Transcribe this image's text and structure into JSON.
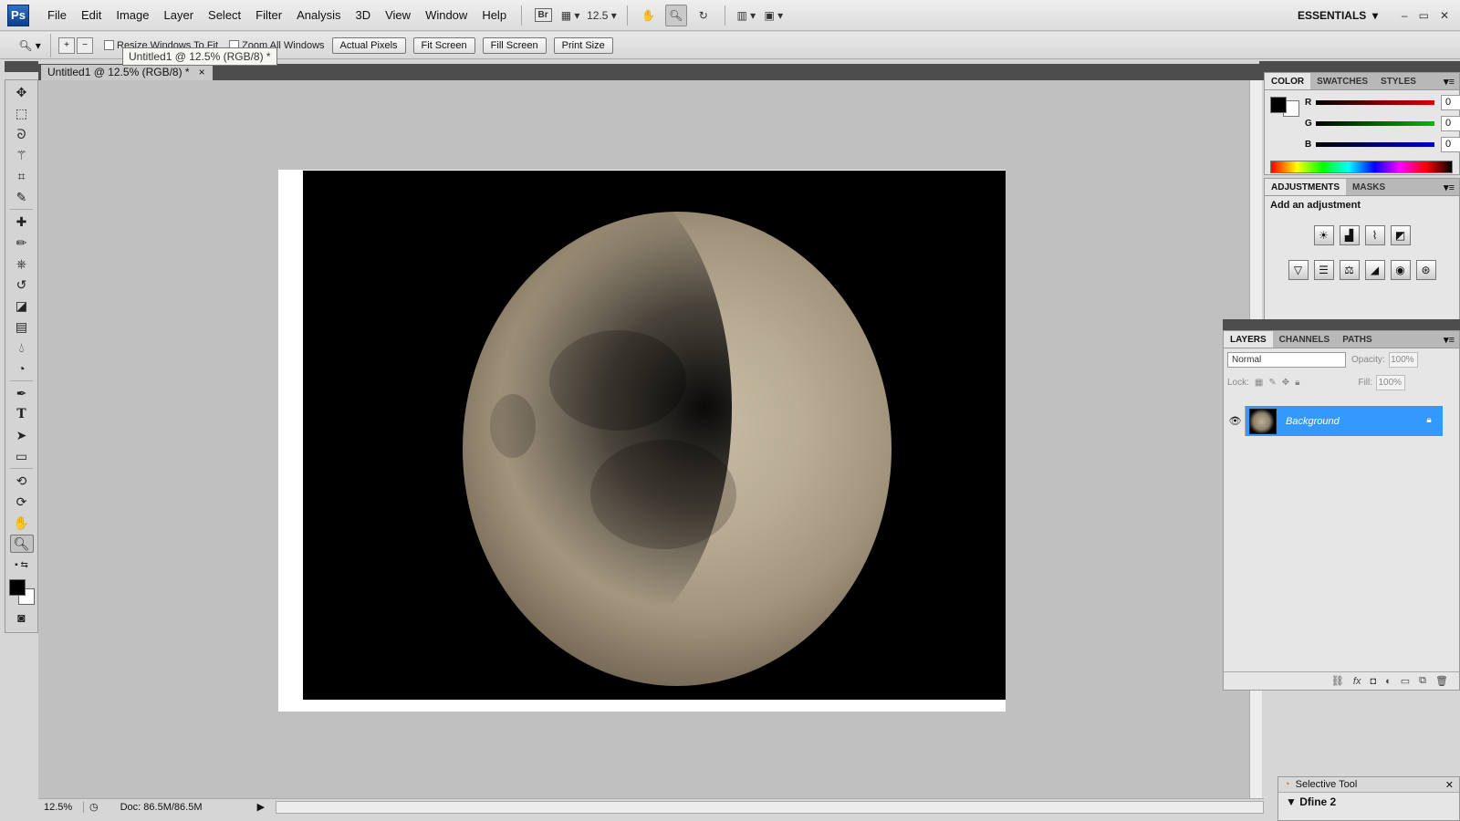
{
  "menubar": {
    "logo": "Ps",
    "items": [
      "File",
      "Edit",
      "Image",
      "Layer",
      "Select",
      "Filter",
      "Analysis",
      "3D",
      "View",
      "Window",
      "Help"
    ],
    "bridge": "Br",
    "zoom_value": "12.5",
    "workspace": "ESSENTIALS",
    "window_controls": [
      "–",
      "▭",
      "✕"
    ]
  },
  "options": {
    "checks": [
      "Resize Windows To Fit",
      "Zoom All Windows"
    ],
    "buttons": [
      "Actual Pixels",
      "Fit Screen",
      "Fill Screen",
      "Print Size"
    ],
    "tooltip": "Untitled1 @ 12.5% (RGB/8) *"
  },
  "document": {
    "tab_title": "Untitled1 @ 12.5% (RGB/8) *",
    "close": "×"
  },
  "status": {
    "zoom": "12.5%",
    "doc_size": "Doc: 86.5M/86.5M"
  },
  "color_panel": {
    "tabs": [
      "COLOR",
      "SWATCHES",
      "STYLES"
    ],
    "channels": [
      {
        "label": "R",
        "value": "0",
        "color": "#dd0000"
      },
      {
        "label": "G",
        "value": "0",
        "color": "#00bb00"
      },
      {
        "label": "B",
        "value": "0",
        "color": "#0000cc"
      }
    ]
  },
  "adjustments_panel": {
    "tabs": [
      "ADJUSTMENTS",
      "MASKS"
    ],
    "heading": "Add an adjustment"
  },
  "layers_panel": {
    "tabs": [
      "LAYERS",
      "CHANNELS",
      "PATHS"
    ],
    "blend_mode": "Normal",
    "opacity_label": "Opacity:",
    "opacity": "100%",
    "lock_label": "Lock:",
    "fill_label": "Fill:",
    "fill": "100%",
    "layer_name": "Background",
    "selected_color": "#3399ff"
  },
  "selective_tool": {
    "title": "Selective Tool",
    "item": "Dfine 2"
  }
}
